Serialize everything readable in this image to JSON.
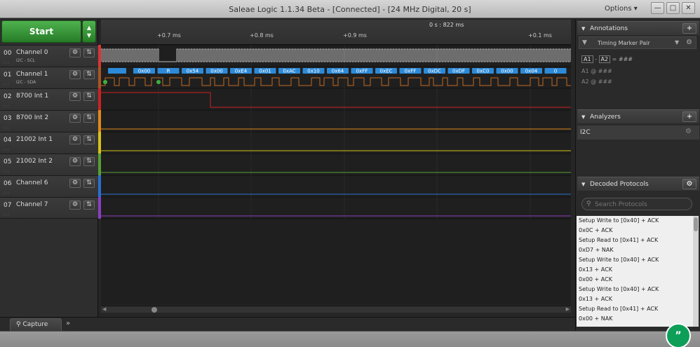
{
  "window": {
    "title": "Saleae Logic 1.1.34 Beta - [Connected] - [24 MHz Digital, 20 s]",
    "options_label": "Options ▾"
  },
  "toolbar": {
    "start_label": "Start"
  },
  "timeline": {
    "cursor_time": "0 s : 822 ms",
    "ticks": [
      "+0.7 ms",
      "+0.8 ms",
      "+0.9 ms",
      "+0.1 ms"
    ]
  },
  "channels": [
    {
      "num": "00",
      "name": "Channel 0",
      "sub": "I2C - SCL",
      "color": "#dd3333"
    },
    {
      "num": "01",
      "name": "Channel 1",
      "sub": "I2C - SDA",
      "color": "#aa5522"
    },
    {
      "num": "02",
      "name": "8700 Int 1",
      "sub": "",
      "color": "#cc2222"
    },
    {
      "num": "03",
      "name": "8700 Int 2",
      "sub": "",
      "color": "#e08a1a"
    },
    {
      "num": "04",
      "name": "21002 Int 1",
      "sub": "",
      "color": "#d6c21a"
    },
    {
      "num": "05",
      "name": "21002 Int 2",
      "sub": "",
      "color": "#55a033"
    },
    {
      "num": "06",
      "name": "Channel 6",
      "sub": "",
      "color": "#2a6fd0"
    },
    {
      "num": "07",
      "name": "Channel 7",
      "sub": "",
      "color": "#8a3fc0"
    }
  ],
  "i2c_frames": [
    "0x00",
    "R",
    "0x54",
    "0x00",
    "0xE4",
    "0x01",
    "0xAC",
    "0x10",
    "0x64",
    "0xFF",
    "0xEC",
    "0xFF",
    "0xDC",
    "0xDF",
    "0xC0",
    "0x00",
    "0x04",
    "0"
  ],
  "bottom": {
    "capture_tab": "Capture",
    "more_tabs": "»"
  },
  "annotations": {
    "title": "Annotations",
    "add": "+",
    "marker_pair": "Timing Marker Pair",
    "pair_line": {
      "a1": "A1",
      "dash": "-",
      "a2": "A2",
      "eq": "= ###"
    },
    "a1_label": "A1",
    "a1_val": "@ ###",
    "a2_label": "A2",
    "a2_val": "@ ###"
  },
  "analyzers": {
    "title": "Analyzers",
    "add": "+",
    "items": [
      "I2C"
    ]
  },
  "decoded": {
    "title": "Decoded Protocols",
    "search_placeholder": "Search Protocols",
    "items": [
      "Setup Write to [0x40] + ACK",
      "0x0C + ACK",
      "Setup Read to [0x41] + ACK",
      "0xD7 + NAK",
      "Setup Write to [0x40] + ACK",
      "0x13 + ACK",
      "0x00 + ACK",
      "Setup Write to [0x40] + ACK",
      "0x13 + ACK",
      "Setup Read to [0x41] + ACK",
      "0x00 + NAK"
    ]
  },
  "hangouts": {
    "glyph": "”"
  }
}
